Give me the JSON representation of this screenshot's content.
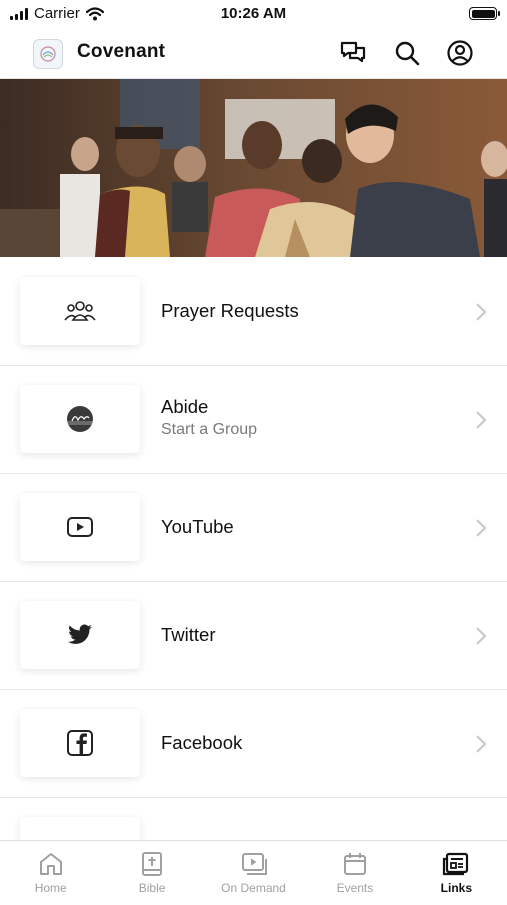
{
  "status": {
    "carrier": "Carrier",
    "time": "10:26 AM"
  },
  "header": {
    "title": "Covenant"
  },
  "list": [
    {
      "label": "Prayer Requests",
      "subtitle": "",
      "icon": "prayer-group-icon"
    },
    {
      "label": "Abide",
      "subtitle": "Start a Group",
      "icon": "abide-logo-icon"
    },
    {
      "label": "YouTube",
      "subtitle": "",
      "icon": "youtube-icon"
    },
    {
      "label": "Twitter",
      "subtitle": "",
      "icon": "twitter-icon"
    },
    {
      "label": "Facebook",
      "subtitle": "",
      "icon": "facebook-icon"
    }
  ],
  "tabs": [
    {
      "label": "Home",
      "icon": "home-icon",
      "active": false
    },
    {
      "label": "Bible",
      "icon": "bible-icon",
      "active": false
    },
    {
      "label": "On Demand",
      "icon": "on-demand-icon",
      "active": false
    },
    {
      "label": "Events",
      "icon": "calendar-icon",
      "active": false
    },
    {
      "label": "Links",
      "icon": "links-icon",
      "active": true
    }
  ],
  "colors": {
    "text": "#111111",
    "muted": "#7a7a7a",
    "inactive_tab": "#a0a0a0",
    "divider": "#e8e8e8"
  }
}
